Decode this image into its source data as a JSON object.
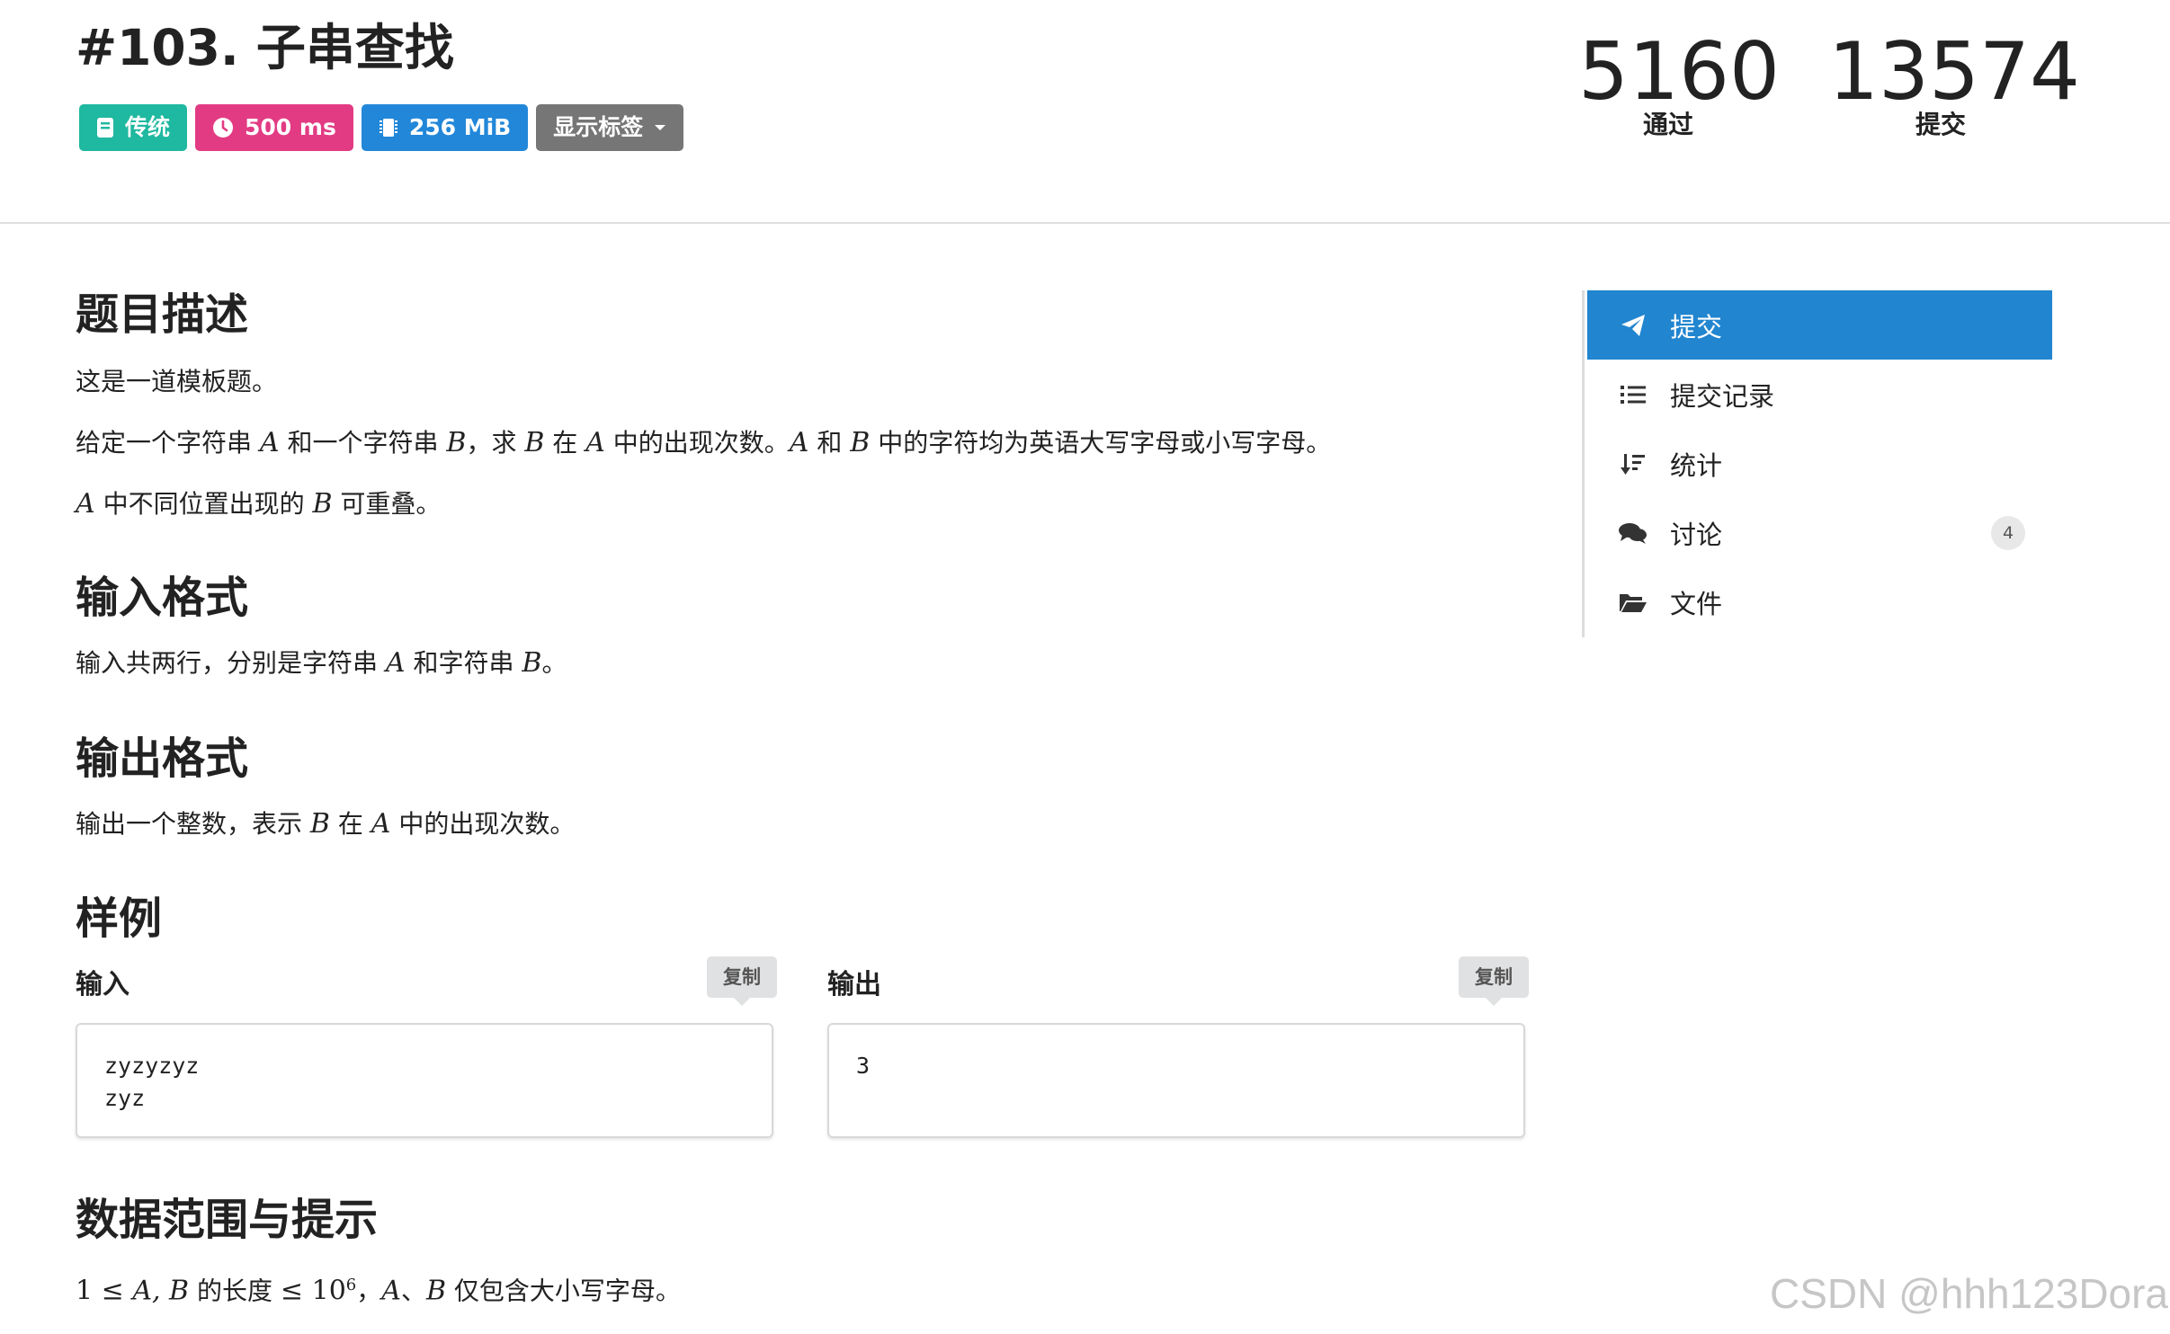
{
  "header": {
    "title": "#103. 子串查找",
    "labels": {
      "type": "传统",
      "time": "500 ms",
      "memory": "256 MiB",
      "show_tags": "显示标签"
    },
    "stats": {
      "accepted_value": "5160",
      "accepted_label": "通过",
      "submitted_value": "13574",
      "submitted_label": "提交"
    }
  },
  "sections": {
    "description": {
      "title": "题目描述",
      "line1": "这是一道模板题。",
      "line2_p1": "给定一个字符串 ",
      "line2_A": "A",
      "line2_p2": " 和一个字符串 ",
      "line2_B": "B",
      "line2_p3": "，求 ",
      "line2_B2": "B",
      "line2_p4": " 在 ",
      "line2_A2": "A",
      "line2_p5": " 中的出现次数。",
      "line2_A3": "A",
      "line2_p6": " 和 ",
      "line2_B3": "B",
      "line2_p7": " 中的字符均为英语大写字母或小写字母。",
      "line3_A": "A",
      "line3_p1": " 中不同位置出现的 ",
      "line3_B": "B",
      "line3_p2": " 可重叠。"
    },
    "input_format": {
      "title": "输入格式",
      "p1": "输入共两行，分别是字符串 ",
      "A": "A",
      "p2": " 和字符串 ",
      "B": "B",
      "p3": "。"
    },
    "output_format": {
      "title": "输出格式",
      "p1": "输出一个整数，表示 ",
      "B": "B",
      "p2": " 在 ",
      "A": "A",
      "p3": " 中的出现次数。"
    },
    "samples": {
      "title": "样例",
      "input_label": "输入",
      "output_label": "输出",
      "copy_label": "复制",
      "input_value": "zyzyzyz\nzyz",
      "output_value": "3"
    },
    "constraints": {
      "title": "数据范围与提示",
      "one": "1",
      "le1": " ≤ ",
      "AB": "A, B",
      "p1": " 的长度 ",
      "le2": "≤ ",
      "ten": "10",
      "exp": "6",
      "p2": "，",
      "A": "A",
      "sep": "、",
      "B": "B",
      "p3": " 仅包含大小写字母。"
    }
  },
  "sidebar": {
    "items": [
      {
        "label": "提交",
        "icon": "paper-plane-icon",
        "active": true
      },
      {
        "label": "提交记录",
        "icon": "list-icon"
      },
      {
        "label": "统计",
        "icon": "sort-icon"
      },
      {
        "label": "讨论",
        "icon": "comments-icon",
        "badge": "4"
      },
      {
        "label": "文件",
        "icon": "folder-open-icon"
      }
    ]
  },
  "watermark": "CSDN @hhh123Dora",
  "colors": {
    "type_label": "#1fb8a0",
    "time_label": "#e23b83",
    "memory_label": "#2287d9",
    "tags_label": "#767676",
    "sidebar_active": "#2185d0"
  }
}
